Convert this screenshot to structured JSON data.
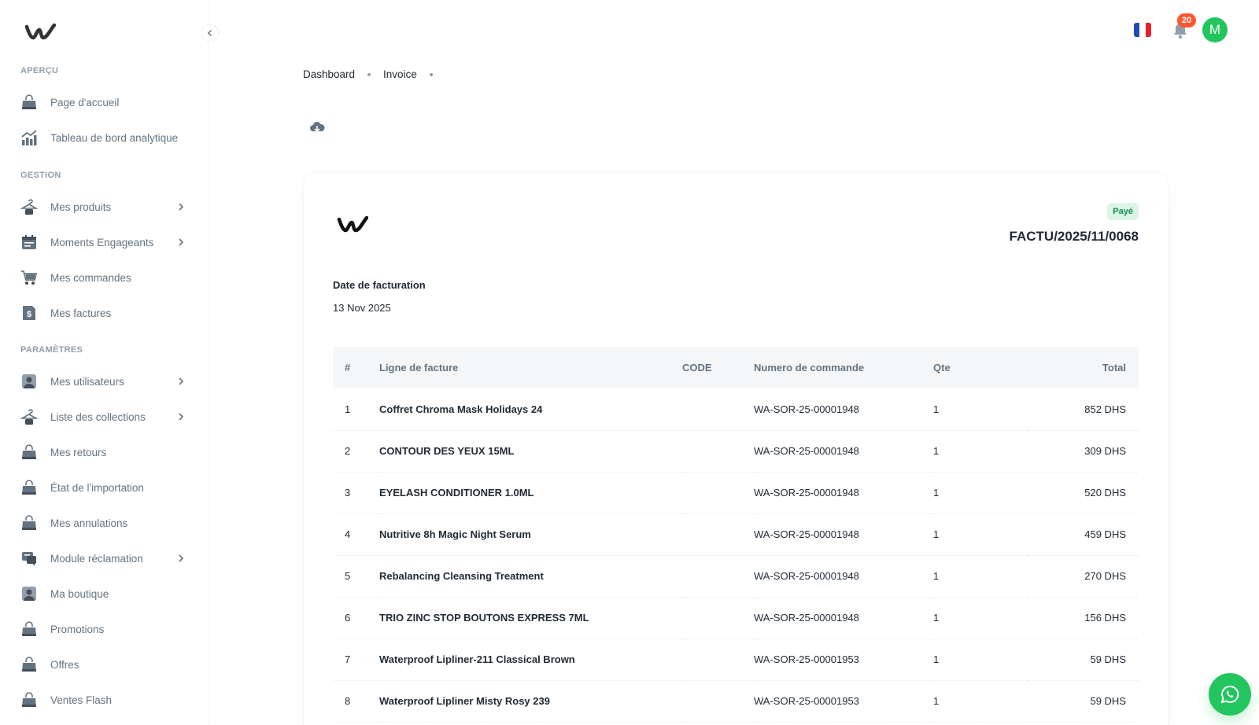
{
  "sidebar": {
    "sections": [
      "Aperçu",
      "Gestion",
      "Paramètres"
    ],
    "items": [
      {
        "label": "Page d'accueil",
        "icon": "bag-icon"
      },
      {
        "label": "Tableau de bord analytique",
        "icon": "analytics-icon"
      },
      {
        "label": "Mes produits",
        "icon": "hanger-icon"
      },
      {
        "label": "Moments Engageants",
        "icon": "calendar-icon"
      },
      {
        "label": "Mes commandes",
        "icon": "cart-icon"
      },
      {
        "label": "Mes factures",
        "icon": "invoice-icon"
      },
      {
        "label": "Mes utilisateurs",
        "icon": "user-icon"
      },
      {
        "label": "Liste des collections",
        "icon": "hanger-icon"
      },
      {
        "label": "Mes retours",
        "icon": "bag-icon"
      },
      {
        "label": "État de l'importation",
        "icon": "bag-icon"
      },
      {
        "label": "Mes annulations",
        "icon": "bag-icon"
      },
      {
        "label": "Module réclamation",
        "icon": "chat-icon"
      },
      {
        "label": "Ma boutique",
        "icon": "user-icon"
      },
      {
        "label": "Promotions",
        "icon": "bag-icon"
      },
      {
        "label": "Offres",
        "icon": "bag-icon"
      },
      {
        "label": "Ventes Flash",
        "icon": "bag-icon"
      }
    ]
  },
  "header": {
    "notifications_count": "20",
    "avatar_initial": "M",
    "language": "fr-flag-icon"
  },
  "breadcrumb": [
    "Dashboard",
    "Invoice"
  ],
  "invoice": {
    "status": "Payé",
    "number": "FACTU/2025/11/0068",
    "date_label": "Date de facturation",
    "date_value": "13 Nov 2025",
    "columns": [
      "#",
      "Ligne de facture",
      "CODE",
      "Numero de commande",
      "Qte",
      "Total"
    ],
    "rows": [
      {
        "num": "1",
        "line": "Coffret Chroma Mask Holidays 24",
        "code": "",
        "order": "WA-SOR-25-00001948",
        "qty": "1",
        "total": "852 DHS"
      },
      {
        "num": "2",
        "line": "CONTOUR DES YEUX 15ML",
        "code": "",
        "order": "WA-SOR-25-00001948",
        "qty": "1",
        "total": "309 DHS"
      },
      {
        "num": "3",
        "line": "EYELASH CONDITIONER 1.0ML",
        "code": "",
        "order": "WA-SOR-25-00001948",
        "qty": "1",
        "total": "520 DHS"
      },
      {
        "num": "4",
        "line": "Nutritive 8h Magic Night Serum",
        "code": "",
        "order": "WA-SOR-25-00001948",
        "qty": "1",
        "total": "459 DHS"
      },
      {
        "num": "5",
        "line": "Rebalancing Cleansing Treatment",
        "code": "",
        "order": "WA-SOR-25-00001948",
        "qty": "1",
        "total": "270 DHS"
      },
      {
        "num": "6",
        "line": "TRIO ZINC STOP BOUTONS EXPRESS 7ML",
        "code": "",
        "order": "WA-SOR-25-00001948",
        "qty": "1",
        "total": "156 DHS"
      },
      {
        "num": "7",
        "line": "Waterproof Lipliner-211 Classical Brown",
        "code": "",
        "order": "WA-SOR-25-00001953",
        "qty": "1",
        "total": "59 DHS"
      },
      {
        "num": "8",
        "line": "Waterproof Lipliner Misty Rosy 239",
        "code": "",
        "order": "WA-SOR-25-00001953",
        "qty": "1",
        "total": "59 DHS"
      }
    ]
  },
  "colors": {
    "accent_green": "#22c55e",
    "badge_red": "#ff5630",
    "status_bg": "#dbf6e5",
    "status_text": "#118d57",
    "icon_grey": "#637381"
  }
}
